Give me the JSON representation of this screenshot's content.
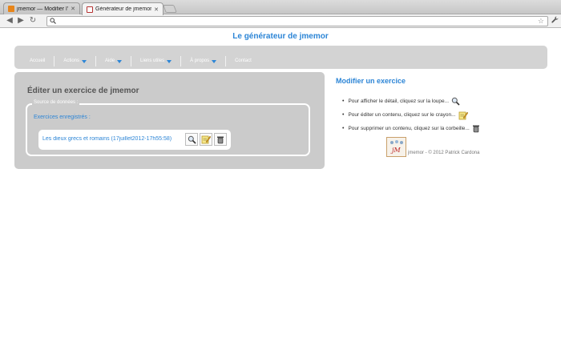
{
  "browser": {
    "tabs": [
      {
        "title": "jmemor — Modifier l'article",
        "active": false
      },
      {
        "title": "Générateur de jmemor",
        "active": true
      }
    ],
    "url": "",
    "icons": {
      "back": "back-arrow-icon",
      "forward": "forward-arrow-icon",
      "reload": "reload-icon",
      "bookmark": "star-icon",
      "menu": "wrench-icon"
    }
  },
  "page": {
    "site_title": "Le générateur de jmemor",
    "nav": [
      {
        "label": "Accueil",
        "dropdown": false
      },
      {
        "label": "Actions",
        "dropdown": true
      },
      {
        "label": "Aide",
        "dropdown": true
      },
      {
        "label": "Liens utiles",
        "dropdown": true
      },
      {
        "label": "À propos",
        "dropdown": true
      },
      {
        "label": "Contact",
        "dropdown": false
      }
    ],
    "left_panel": {
      "title": "Éditer un exercice de jmemor",
      "fieldset_legend": "Source de données :",
      "exercises_label": "Exercices enregistrés :",
      "exercises": [
        {
          "name": "Les dieux grecs et romains (17juillet2012-17h55:58)"
        }
      ]
    },
    "right_panel": {
      "title": "Modifier un exercice",
      "instructions": [
        {
          "text": "Pour afficher le détail, cliquez sur la loupe...",
          "icon": "magnifier-icon"
        },
        {
          "text": "Pour éditer un contenu, cliquez sur le crayon...",
          "icon": "pencil-icon"
        },
        {
          "text": "Pour supprimer un contenu, cliquez sur la corbeille...",
          "icon": "trash-icon"
        }
      ]
    },
    "footer": {
      "logo_text": "jM",
      "copyright": "jmemor - © 2012 Patrick Cardona"
    },
    "colors": {
      "accent": "#2c85d6",
      "panel": "#cbcbcb",
      "navbar": "#d3d3d3"
    }
  }
}
